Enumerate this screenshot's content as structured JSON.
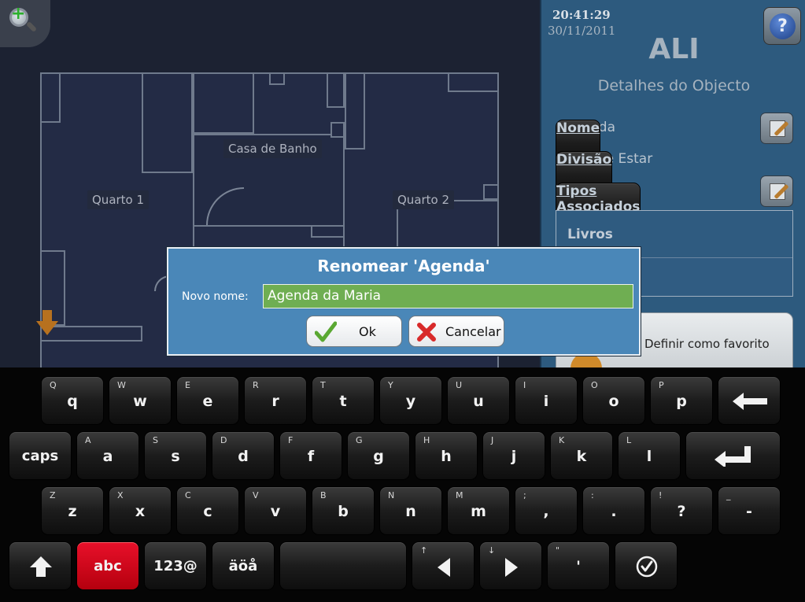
{
  "status": {
    "time": "20:41:29",
    "date": "30/11/2011"
  },
  "object": {
    "title": "ALI",
    "subtitle": "Detalhes do Objecto",
    "name_key": "Nome",
    "name_value": ": Agenda",
    "division_key": "Divisão",
    "division_value": ": Sala de Estar",
    "types_key": "Tipos Associados",
    "types_suffix": ":",
    "types": [
      "Livros"
    ],
    "favorite_label": "Definir como favorito"
  },
  "help": {
    "label": "?"
  },
  "map": {
    "rooms": [
      "Casa de Banho",
      "Quarto 1",
      "Quarto 2"
    ]
  },
  "dialog": {
    "title": "Renomear 'Agenda'",
    "field_label": "Novo nome:",
    "field_value": "Agenda da Maria",
    "ok_label": "Ok",
    "cancel_label": "Cancelar"
  },
  "keyboard": {
    "row1": [
      {
        "main": "q",
        "sec": "Q"
      },
      {
        "main": "w",
        "sec": "W"
      },
      {
        "main": "e",
        "sec": "E"
      },
      {
        "main": "r",
        "sec": "R"
      },
      {
        "main": "t",
        "sec": "T"
      },
      {
        "main": "y",
        "sec": "Y"
      },
      {
        "main": "u",
        "sec": "U"
      },
      {
        "main": "i",
        "sec": "I"
      },
      {
        "main": "o",
        "sec": "O"
      },
      {
        "main": "p",
        "sec": "P"
      }
    ],
    "row2": [
      {
        "main": "caps",
        "sec": ""
      },
      {
        "main": "a",
        "sec": "A"
      },
      {
        "main": "s",
        "sec": "S"
      },
      {
        "main": "d",
        "sec": "D"
      },
      {
        "main": "f",
        "sec": "F"
      },
      {
        "main": "g",
        "sec": "G"
      },
      {
        "main": "h",
        "sec": "H"
      },
      {
        "main": "j",
        "sec": "J"
      },
      {
        "main": "k",
        "sec": "K"
      },
      {
        "main": "l",
        "sec": "L"
      }
    ],
    "row3": [
      {
        "main": "z",
        "sec": "Z"
      },
      {
        "main": "x",
        "sec": "X"
      },
      {
        "main": "c",
        "sec": "C"
      },
      {
        "main": "v",
        "sec": "V"
      },
      {
        "main": "b",
        "sec": "B"
      },
      {
        "main": "n",
        "sec": "N"
      },
      {
        "main": "m",
        "sec": "M"
      },
      {
        "main": ",",
        "sec": ";"
      },
      {
        "main": ".",
        "sec": ":"
      },
      {
        "main": "?",
        "sec": "!"
      },
      {
        "main": "-",
        "sec": "_"
      }
    ],
    "row4": {
      "abc": "abc",
      "num": "123@",
      "special": "äöå",
      "left_sec": "↑",
      "right_sec": "↓",
      "quote_main": "'",
      "quote_sec": "\""
    }
  },
  "colors": {
    "panel": "#2d5a7e",
    "dialog": "#4a87b8",
    "input": "#6fae52",
    "abc_key": "#d80a1e"
  }
}
